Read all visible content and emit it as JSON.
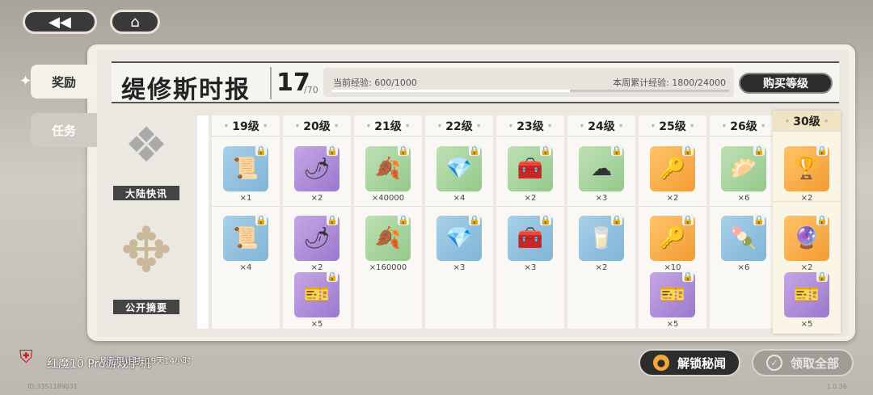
{
  "nav": {
    "back_icon": "◀◀",
    "home_icon": "⌂"
  },
  "side_tabs": {
    "reward": "奖励",
    "task": "任务"
  },
  "header": {
    "title": "缇修斯时报",
    "level": "17",
    "level_max": "/70",
    "current_exp": "当前经验: 600/1000",
    "weekly_exp": "本周累计经验: 1800/24000",
    "exp_progress": 0.6,
    "buy_label": "购买等级"
  },
  "rows": {
    "free_label": "大陆快讯",
    "paid_label": "公开摘要"
  },
  "columns": [
    {
      "level": "19级",
      "free": [
        {
          "icon": "📜",
          "color": "blue",
          "qty": "×1"
        }
      ],
      "paid": [
        {
          "icon": "📜",
          "color": "blue",
          "qty": "×4"
        }
      ]
    },
    {
      "level": "20级",
      "free": [
        {
          "icon": "🌶",
          "color": "purple",
          "qty": "×2"
        }
      ],
      "paid": [
        {
          "icon": "🌶",
          "color": "purple",
          "qty": "×2"
        },
        {
          "icon": "🎫",
          "color": "purple",
          "qty": "×5"
        }
      ]
    },
    {
      "level": "21级",
      "free": [
        {
          "icon": "🍂",
          "color": "green",
          "qty": "×40000"
        }
      ],
      "paid": [
        {
          "icon": "🍂",
          "color": "green",
          "qty": "×160000"
        }
      ]
    },
    {
      "level": "22级",
      "free": [
        {
          "icon": "💎",
          "color": "green",
          "qty": "×4"
        }
      ],
      "paid": [
        {
          "icon": "💎",
          "color": "blue",
          "qty": "×3"
        }
      ]
    },
    {
      "level": "23级",
      "free": [
        {
          "icon": "🧰",
          "color": "green",
          "qty": "×2"
        }
      ],
      "paid": [
        {
          "icon": "🧰",
          "color": "blue",
          "qty": "×3"
        }
      ]
    },
    {
      "level": "24级",
      "free": [
        {
          "icon": "☁",
          "color": "green",
          "qty": "×3"
        }
      ],
      "paid": [
        {
          "icon": "🥛",
          "color": "blue",
          "qty": "×2"
        }
      ]
    },
    {
      "level": "25级",
      "free": [
        {
          "icon": "🔑",
          "color": "orange",
          "qty": "×2"
        }
      ],
      "paid": [
        {
          "icon": "🔑",
          "color": "orange",
          "qty": "×10"
        },
        {
          "icon": "🎫",
          "color": "purple",
          "qty": "×5"
        }
      ]
    },
    {
      "level": "26级",
      "free": [
        {
          "icon": "🥟",
          "color": "green",
          "qty": "×6"
        }
      ],
      "paid": [
        {
          "icon": "🍡",
          "color": "blue",
          "qty": "×6"
        }
      ]
    },
    {
      "level": "30级",
      "free": [
        {
          "icon": "🏆",
          "color": "orange",
          "qty": "×2"
        }
      ],
      "paid": [
        {
          "icon": "🔮",
          "color": "orange",
          "qty": "×2"
        },
        {
          "icon": "🎫",
          "color": "purple",
          "qty": "×5"
        }
      ]
    }
  ],
  "footer": {
    "timer": "刷新倒计时: 19天14小时",
    "watermark": "红魔10 Pro游戏手机",
    "player_id": "ID:3351189031",
    "version": "1.0.36",
    "unlock_label": "解锁秘闻",
    "claim_all_label": "领取全部"
  }
}
